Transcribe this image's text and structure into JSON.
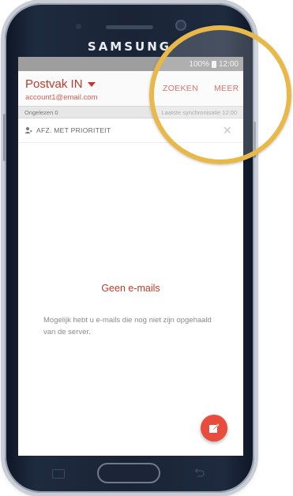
{
  "device": {
    "brand": "SAMSUNG"
  },
  "status_bar": {
    "battery": "100%",
    "time": "12:00"
  },
  "app_bar": {
    "mailbox_title": "Postvak IN",
    "account_email": "account1@email.com",
    "search_label": "ZOEKEN",
    "more_label": "MEER"
  },
  "sync_bar": {
    "unread_label": "Ongelezen 0",
    "last_sync_label": "Laatste synchronisatie 12:00"
  },
  "priority_bar": {
    "label": "AFZ. MET PRIORITEIT"
  },
  "empty_state": {
    "title": "Geen e-mails",
    "description": "Mogelijk hebt u e-mails die nog niet zijn opgehaald van de server."
  },
  "colors": {
    "accent": "#c0392b",
    "fab": "#e74c3c",
    "magnifier_ring": "#e8b94a"
  },
  "icons": {
    "dropdown": "caret-down-icon",
    "priority": "person-icon",
    "close": "close-icon",
    "compose": "compose-icon"
  }
}
